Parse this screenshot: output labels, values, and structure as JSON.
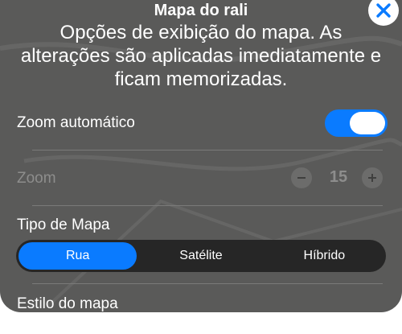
{
  "dialog": {
    "title": "Mapa do rali",
    "description": "Opções de exibição do mapa. As alterações são aplicadas imediatamente e ficam memorizadas."
  },
  "settings": {
    "auto_zoom": {
      "label": "Zoom automático",
      "enabled": true
    },
    "zoom": {
      "label": "Zoom",
      "value": "15",
      "disabled": true
    },
    "map_type": {
      "label": "Tipo de Mapa",
      "options": [
        "Rua",
        "Satélite",
        "Híbrido"
      ],
      "selected": "Rua"
    },
    "map_style": {
      "label": "Estilo do mapa"
    }
  },
  "colors": {
    "accent": "#0a7bff",
    "sheet_bg": "#5a5a59",
    "segment_bg": "#262626"
  },
  "icons": {
    "close": "close-icon",
    "zoom_minus": "minus-icon",
    "zoom_plus": "plus-icon"
  }
}
